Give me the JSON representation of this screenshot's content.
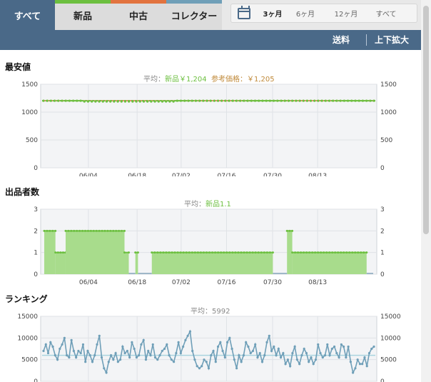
{
  "tabs": [
    {
      "label": "すべて",
      "active": true,
      "stripe": ""
    },
    {
      "label": "新品",
      "active": false,
      "stripe": "#6cbf3f"
    },
    {
      "label": "中古",
      "active": false,
      "stripe": "#e2733f"
    },
    {
      "label": "コレクター",
      "active": false,
      "stripe": "#6f9fb8"
    }
  ],
  "range": {
    "icon": "calendar-icon",
    "options": [
      "3ヶ月",
      "6ヶ月",
      "12ヶ月",
      "すべて"
    ],
    "selected": "3ヶ月"
  },
  "subbar": {
    "shipping_label": "送料",
    "zoom_label": "上下拡大"
  },
  "colors": {
    "accent": "#4a6988",
    "new": "#6cbf3f",
    "ref": "#e2733f",
    "ranking": "#6f9fb8"
  },
  "x_ticks": [
    "06/04",
    "06/18",
    "07/02",
    "07/16",
    "07/30",
    "08/13"
  ],
  "charts": {
    "lowest_price": {
      "title": "最安値",
      "avg_prefix": "平均：",
      "avg_new": "新品￥1,204",
      "avg_ref": "参考価格：￥1,205"
    },
    "sellers": {
      "title": "出品者数",
      "avg_prefix": "平均：",
      "avg_new": "新品1.1"
    },
    "ranking": {
      "title": "ランキング",
      "avg_text": "平均：5992"
    }
  },
  "chart_data": [
    {
      "type": "line",
      "title": "最安値",
      "x": [
        "06/04",
        "06/18",
        "07/02",
        "07/16",
        "07/30",
        "08/13"
      ],
      "ylim": [
        0,
        1500
      ],
      "yticks": [
        0,
        500,
        1000,
        1500
      ],
      "series": [
        {
          "name": "新品",
          "values": [
            1204,
            1204,
            1204,
            1204,
            1204,
            1204
          ]
        },
        {
          "name": "参考価格",
          "values": [
            1205,
            1205,
            1205,
            1205,
            1205,
            1205
          ]
        }
      ]
    },
    {
      "type": "area",
      "title": "出品者数",
      "ylim": [
        0,
        3
      ],
      "yticks": [
        0,
        1,
        2,
        3
      ],
      "series": [
        {
          "name": "新品",
          "segments": [
            {
              "from": 0.0,
              "to": 0.034,
              "value": 2
            },
            {
              "from": 0.034,
              "to": 0.065,
              "value": 1
            },
            {
              "from": 0.065,
              "to": 0.244,
              "value": 2
            },
            {
              "from": 0.244,
              "to": 0.257,
              "value": 1
            },
            {
              "from": 0.277,
              "to": 0.285,
              "value": 1
            },
            {
              "from": 0.327,
              "to": 0.695,
              "value": 1
            },
            {
              "from": 0.738,
              "to": 0.754,
              "value": 2
            },
            {
              "from": 0.754,
              "to": 0.98,
              "value": 1
            }
          ]
        }
      ]
    },
    {
      "type": "line",
      "title": "ランキング",
      "ylim": [
        0,
        15000
      ],
      "yticks": [
        0,
        5000,
        10000,
        15000
      ],
      "average": 5992,
      "series": [
        {
          "name": "ランキング",
          "values": [
            7000,
            8500,
            6500,
            9000,
            8000,
            6000,
            5000,
            7500,
            8500,
            10000,
            6000,
            5500,
            9500,
            7000,
            5500,
            7000,
            6500,
            8500,
            4500,
            7000,
            6000,
            4500,
            6000,
            8500,
            10500,
            5500,
            3000,
            2000,
            4500,
            6000,
            5000,
            6500,
            4500,
            5000,
            8000,
            6500,
            7000,
            5500,
            9000,
            7500,
            5500,
            6000,
            8500,
            9500,
            5000,
            7000,
            6000,
            8500,
            5500,
            5000,
            6000,
            7000,
            7500,
            8500,
            6000,
            5000,
            4500,
            6500,
            9000,
            6500,
            8000,
            9500,
            10500,
            11500,
            7000,
            5000,
            3500,
            3000,
            3500,
            5000,
            4500,
            3000,
            6000,
            7000,
            4500,
            8000,
            9000,
            7000,
            5500,
            9000,
            10000,
            7500,
            5000,
            3000,
            6000,
            4500,
            6000,
            9000,
            8000,
            6500,
            7000,
            8500,
            5500,
            6500,
            4500,
            6000,
            9000,
            10500,
            7000,
            8000,
            6000,
            7500,
            5500,
            6500,
            4000,
            5000,
            3500,
            6500,
            8000,
            5000,
            4000,
            6000,
            7500,
            6500,
            4500,
            5500,
            4000,
            5000,
            8500,
            6500,
            5500,
            6000,
            8500,
            6000,
            7500,
            8000,
            6500,
            5500,
            8500,
            8000,
            5500,
            8000,
            4500,
            2000,
            3000,
            5000,
            4000,
            4000,
            5500,
            3500,
            6500,
            7500,
            8000
          ]
        }
      ]
    }
  ]
}
